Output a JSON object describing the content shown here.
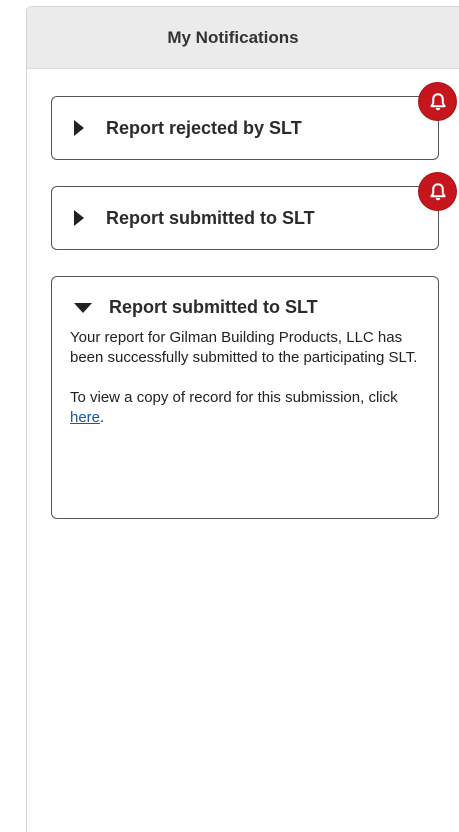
{
  "header": {
    "title": "My Notifications"
  },
  "notifications": [
    {
      "title": "Report rejected by SLT",
      "expanded": false,
      "icon": "bell-icon"
    },
    {
      "title": "Report submitted to SLT",
      "expanded": false,
      "icon": "bell-icon"
    },
    {
      "title": "Report submitted to SLT",
      "expanded": true,
      "body_paragraph_1": "Your report for Gilman Building Products, LLC has been successfully submitted to the participating SLT.",
      "body_paragraph_2_prefix": "To view a copy of record for this submission, click ",
      "body_paragraph_2_link": "here",
      "body_paragraph_2_suffix": "."
    }
  ],
  "colors": {
    "badge": "#c4161c",
    "header_bg": "#ebebeb",
    "link": "#1a57a6"
  }
}
